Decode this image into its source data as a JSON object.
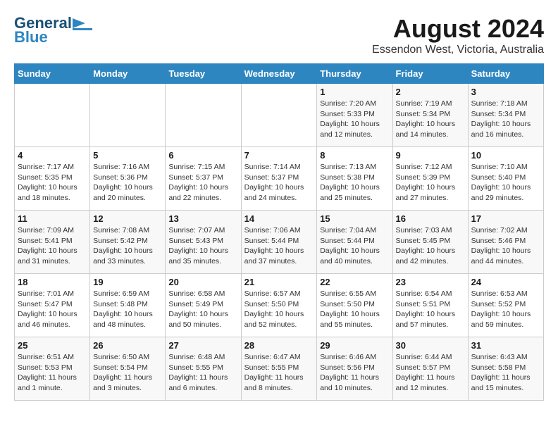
{
  "header": {
    "logo_general": "General",
    "logo_blue": "Blue",
    "title": "August 2024",
    "subtitle": "Essendon West, Victoria, Australia"
  },
  "days_of_week": [
    "Sunday",
    "Monday",
    "Tuesday",
    "Wednesday",
    "Thursday",
    "Friday",
    "Saturday"
  ],
  "weeks": [
    [
      {
        "day": "",
        "info": ""
      },
      {
        "day": "",
        "info": ""
      },
      {
        "day": "",
        "info": ""
      },
      {
        "day": "",
        "info": ""
      },
      {
        "day": "1",
        "info": "Sunrise: 7:20 AM\nSunset: 5:33 PM\nDaylight: 10 hours\nand 12 minutes."
      },
      {
        "day": "2",
        "info": "Sunrise: 7:19 AM\nSunset: 5:34 PM\nDaylight: 10 hours\nand 14 minutes."
      },
      {
        "day": "3",
        "info": "Sunrise: 7:18 AM\nSunset: 5:34 PM\nDaylight: 10 hours\nand 16 minutes."
      }
    ],
    [
      {
        "day": "4",
        "info": "Sunrise: 7:17 AM\nSunset: 5:35 PM\nDaylight: 10 hours\nand 18 minutes."
      },
      {
        "day": "5",
        "info": "Sunrise: 7:16 AM\nSunset: 5:36 PM\nDaylight: 10 hours\nand 20 minutes."
      },
      {
        "day": "6",
        "info": "Sunrise: 7:15 AM\nSunset: 5:37 PM\nDaylight: 10 hours\nand 22 minutes."
      },
      {
        "day": "7",
        "info": "Sunrise: 7:14 AM\nSunset: 5:37 PM\nDaylight: 10 hours\nand 24 minutes."
      },
      {
        "day": "8",
        "info": "Sunrise: 7:13 AM\nSunset: 5:38 PM\nDaylight: 10 hours\nand 25 minutes."
      },
      {
        "day": "9",
        "info": "Sunrise: 7:12 AM\nSunset: 5:39 PM\nDaylight: 10 hours\nand 27 minutes."
      },
      {
        "day": "10",
        "info": "Sunrise: 7:10 AM\nSunset: 5:40 PM\nDaylight: 10 hours\nand 29 minutes."
      }
    ],
    [
      {
        "day": "11",
        "info": "Sunrise: 7:09 AM\nSunset: 5:41 PM\nDaylight: 10 hours\nand 31 minutes."
      },
      {
        "day": "12",
        "info": "Sunrise: 7:08 AM\nSunset: 5:42 PM\nDaylight: 10 hours\nand 33 minutes."
      },
      {
        "day": "13",
        "info": "Sunrise: 7:07 AM\nSunset: 5:43 PM\nDaylight: 10 hours\nand 35 minutes."
      },
      {
        "day": "14",
        "info": "Sunrise: 7:06 AM\nSunset: 5:44 PM\nDaylight: 10 hours\nand 37 minutes."
      },
      {
        "day": "15",
        "info": "Sunrise: 7:04 AM\nSunset: 5:44 PM\nDaylight: 10 hours\nand 40 minutes."
      },
      {
        "day": "16",
        "info": "Sunrise: 7:03 AM\nSunset: 5:45 PM\nDaylight: 10 hours\nand 42 minutes."
      },
      {
        "day": "17",
        "info": "Sunrise: 7:02 AM\nSunset: 5:46 PM\nDaylight: 10 hours\nand 44 minutes."
      }
    ],
    [
      {
        "day": "18",
        "info": "Sunrise: 7:01 AM\nSunset: 5:47 PM\nDaylight: 10 hours\nand 46 minutes."
      },
      {
        "day": "19",
        "info": "Sunrise: 6:59 AM\nSunset: 5:48 PM\nDaylight: 10 hours\nand 48 minutes."
      },
      {
        "day": "20",
        "info": "Sunrise: 6:58 AM\nSunset: 5:49 PM\nDaylight: 10 hours\nand 50 minutes."
      },
      {
        "day": "21",
        "info": "Sunrise: 6:57 AM\nSunset: 5:50 PM\nDaylight: 10 hours\nand 52 minutes."
      },
      {
        "day": "22",
        "info": "Sunrise: 6:55 AM\nSunset: 5:50 PM\nDaylight: 10 hours\nand 55 minutes."
      },
      {
        "day": "23",
        "info": "Sunrise: 6:54 AM\nSunset: 5:51 PM\nDaylight: 10 hours\nand 57 minutes."
      },
      {
        "day": "24",
        "info": "Sunrise: 6:53 AM\nSunset: 5:52 PM\nDaylight: 10 hours\nand 59 minutes."
      }
    ],
    [
      {
        "day": "25",
        "info": "Sunrise: 6:51 AM\nSunset: 5:53 PM\nDaylight: 11 hours\nand 1 minute."
      },
      {
        "day": "26",
        "info": "Sunrise: 6:50 AM\nSunset: 5:54 PM\nDaylight: 11 hours\nand 3 minutes."
      },
      {
        "day": "27",
        "info": "Sunrise: 6:48 AM\nSunset: 5:55 PM\nDaylight: 11 hours\nand 6 minutes."
      },
      {
        "day": "28",
        "info": "Sunrise: 6:47 AM\nSunset: 5:55 PM\nDaylight: 11 hours\nand 8 minutes."
      },
      {
        "day": "29",
        "info": "Sunrise: 6:46 AM\nSunset: 5:56 PM\nDaylight: 11 hours\nand 10 minutes."
      },
      {
        "day": "30",
        "info": "Sunrise: 6:44 AM\nSunset: 5:57 PM\nDaylight: 11 hours\nand 12 minutes."
      },
      {
        "day": "31",
        "info": "Sunrise: 6:43 AM\nSunset: 5:58 PM\nDaylight: 11 hours\nand 15 minutes."
      }
    ]
  ]
}
